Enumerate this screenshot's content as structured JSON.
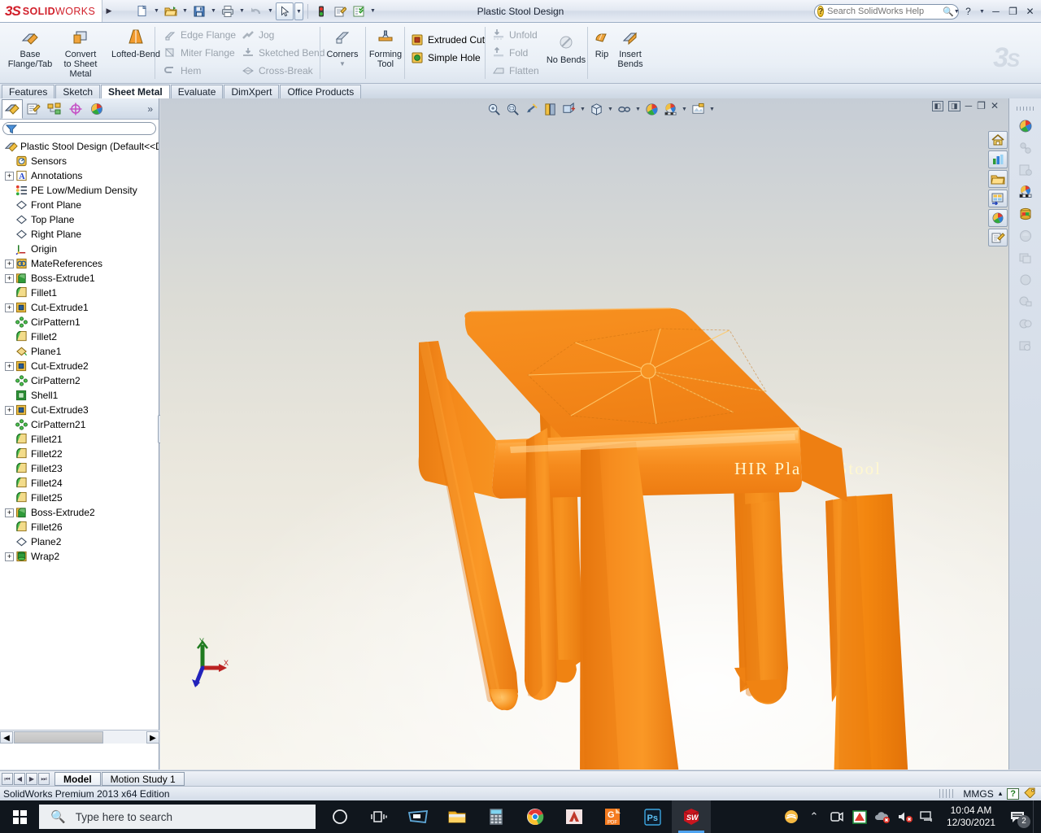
{
  "titlebar": {
    "brand_ds": "3S",
    "brand_name_upper": "SOLID",
    "brand_name_lower": "WORKS",
    "document_title": "Plastic Stool Design",
    "search_placeholder": "Search SolidWorks Help",
    "quick_access": [
      {
        "name": "new-document",
        "glyph": "⬜"
      },
      {
        "name": "open-document",
        "glyph": "📂"
      },
      {
        "name": "save-document",
        "glyph": "💾"
      },
      {
        "name": "print-document",
        "glyph": "🖨"
      },
      {
        "name": "undo",
        "glyph": "↶"
      },
      {
        "name": "select-pointer",
        "glyph": "➤"
      },
      {
        "name": "rebuild-traffic-light",
        "glyph": "🚦"
      },
      {
        "name": "options-gear",
        "glyph": "📝"
      },
      {
        "name": "custom-properties",
        "glyph": "📋"
      }
    ],
    "window_buttons": [
      "help",
      "minimize",
      "restore",
      "close"
    ]
  },
  "ribbon": {
    "groups": [
      {
        "name": "base-group",
        "big_buttons": [
          {
            "label": "Base\nFlange/Tab",
            "icon": "base-flange-icon"
          },
          {
            "label": "Convert\nto Sheet\nMetal",
            "icon": "convert-sheet-metal-icon"
          },
          {
            "label": "Lofted-Bend",
            "icon": "lofted-bend-icon"
          }
        ]
      },
      {
        "name": "flange-group",
        "column_a": [
          {
            "label": "Edge Flange",
            "icon": "edge-flange-icon",
            "enabled": false
          },
          {
            "label": "Miter Flange",
            "icon": "miter-flange-icon",
            "enabled": false
          },
          {
            "label": "Hem",
            "icon": "hem-icon",
            "enabled": false
          }
        ],
        "column_b": [
          {
            "label": "Jog",
            "icon": "jog-icon",
            "enabled": false
          },
          {
            "label": "Sketched Bend",
            "icon": "sketched-bend-icon",
            "enabled": false
          },
          {
            "label": "Cross-Break",
            "icon": "cross-break-icon",
            "enabled": false
          }
        ]
      },
      {
        "name": "corners-group",
        "big_buttons": [
          {
            "label": "Corners",
            "icon": "corners-icon"
          }
        ],
        "has_dropdown": true
      },
      {
        "name": "forming-group",
        "big_buttons": [
          {
            "label": "Forming\nTool",
            "icon": "forming-tool-icon"
          }
        ]
      },
      {
        "name": "cut-group",
        "column_a": [
          {
            "label": "Extruded Cut",
            "icon": "extruded-cut-icon",
            "enabled": true
          },
          {
            "label": "Simple Hole",
            "icon": "simple-hole-icon",
            "enabled": true
          }
        ]
      },
      {
        "name": "fold-group",
        "column_a": [
          {
            "label": "Unfold",
            "icon": "unfold-icon",
            "enabled": false
          },
          {
            "label": "Fold",
            "icon": "fold-icon",
            "enabled": false
          },
          {
            "label": "Flatten",
            "icon": "flatten-icon",
            "enabled": false
          }
        ],
        "big_buttons": [
          {
            "label": "No Bends",
            "icon": "no-bends-icon"
          }
        ]
      },
      {
        "name": "rip-group",
        "big_buttons": [
          {
            "label": "Rip",
            "icon": "rip-icon"
          },
          {
            "label": "Insert\nBends",
            "icon": "insert-bends-icon"
          }
        ]
      }
    ]
  },
  "command_tabs": [
    {
      "label": "Features",
      "active": false
    },
    {
      "label": "Sketch",
      "active": false
    },
    {
      "label": "Sheet Metal",
      "active": true
    },
    {
      "label": "Evaluate",
      "active": false
    },
    {
      "label": "DimXpert",
      "active": false
    },
    {
      "label": "Office Products",
      "active": false
    }
  ],
  "tree_panel": {
    "tabs": [
      {
        "name": "feature-manager-tab",
        "active": true
      },
      {
        "name": "property-manager-tab",
        "active": false
      },
      {
        "name": "configuration-manager-tab",
        "active": false
      },
      {
        "name": "dimxpert-manager-tab",
        "active": false
      },
      {
        "name": "display-manager-tab",
        "active": false
      }
    ],
    "chevron": "»",
    "filter_placeholder": "",
    "root": "Plastic Stool Design  (Default<<D",
    "items": [
      {
        "label": "Sensors",
        "icon": "sensors-icon",
        "expandable": false
      },
      {
        "label": "Annotations",
        "icon": "annotations-icon",
        "expandable": true
      },
      {
        "label": "PE Low/Medium Density",
        "icon": "material-icon",
        "expandable": false
      },
      {
        "label": "Front Plane",
        "icon": "plane-icon",
        "expandable": false
      },
      {
        "label": "Top Plane",
        "icon": "plane-icon",
        "expandable": false
      },
      {
        "label": "Right Plane",
        "icon": "plane-icon",
        "expandable": false
      },
      {
        "label": "Origin",
        "icon": "origin-icon",
        "expandable": false
      },
      {
        "label": "MateReferences",
        "icon": "mate-references-icon",
        "expandable": true
      },
      {
        "label": "Boss-Extrude1",
        "icon": "boss-extrude-icon",
        "expandable": true
      },
      {
        "label": "Fillet1",
        "icon": "fillet-icon",
        "expandable": false
      },
      {
        "label": "Cut-Extrude1",
        "icon": "cut-extrude-icon",
        "expandable": true
      },
      {
        "label": "CirPattern1",
        "icon": "circular-pattern-icon",
        "expandable": false
      },
      {
        "label": "Fillet2",
        "icon": "fillet-icon",
        "expandable": false
      },
      {
        "label": "Plane1",
        "icon": "plane-yellow-icon",
        "expandable": false
      },
      {
        "label": "Cut-Extrude2",
        "icon": "cut-extrude-icon",
        "expandable": true
      },
      {
        "label": "CirPattern2",
        "icon": "circular-pattern-icon",
        "expandable": false
      },
      {
        "label": "Shell1",
        "icon": "shell-icon",
        "expandable": false
      },
      {
        "label": "Cut-Extrude3",
        "icon": "cut-extrude-icon",
        "expandable": true
      },
      {
        "label": "CirPattern21",
        "icon": "circular-pattern-icon",
        "expandable": false
      },
      {
        "label": "Fillet21",
        "icon": "fillet-icon",
        "expandable": false
      },
      {
        "label": "Fillet22",
        "icon": "fillet-icon",
        "expandable": false
      },
      {
        "label": "Fillet23",
        "icon": "fillet-icon",
        "expandable": false
      },
      {
        "label": "Fillet24",
        "icon": "fillet-icon",
        "expandable": false
      },
      {
        "label": "Fillet25",
        "icon": "fillet-icon",
        "expandable": false
      },
      {
        "label": "Boss-Extrude2",
        "icon": "boss-extrude-icon",
        "expandable": true
      },
      {
        "label": "Fillet26",
        "icon": "fillet-icon",
        "expandable": false
      },
      {
        "label": "Plane2",
        "icon": "plane-icon",
        "expandable": false
      },
      {
        "label": "Wrap2",
        "icon": "wrap-icon",
        "expandable": true
      }
    ]
  },
  "view_toolbar": [
    {
      "name": "zoom-to-fit-icon"
    },
    {
      "name": "zoom-to-area-icon"
    },
    {
      "name": "previous-view-icon"
    },
    {
      "name": "section-view-icon"
    },
    {
      "name": "view-orientation-icon",
      "has_caret": true
    },
    {
      "name": "display-style-icon",
      "has_caret": true
    },
    {
      "name": "hide-show-items-icon",
      "has_caret": true
    },
    {
      "name": "edit-appearance-icon"
    },
    {
      "name": "apply-scene-icon",
      "has_caret": true
    },
    {
      "name": "view-settings-icon",
      "has_caret": true
    }
  ],
  "viewport_dock": [
    {
      "name": "view-home-icon"
    },
    {
      "name": "view-chart-icon"
    },
    {
      "name": "view-folder-icon"
    },
    {
      "name": "view-layout-icon"
    },
    {
      "name": "view-appearance-icon"
    },
    {
      "name": "view-custom-icon"
    }
  ],
  "task_pane": [
    {
      "name": "solidworks-resources-icon"
    },
    {
      "name": "design-library-icon"
    },
    {
      "name": "file-explorer-icon"
    },
    {
      "name": "view-palette-icon"
    },
    {
      "name": "appearances-scenes-icon"
    },
    {
      "name": "custom-properties-icon"
    },
    {
      "name": "photoview-items-icon"
    },
    {
      "name": "photoview-options-icon"
    },
    {
      "name": "photoview-scene-icon"
    },
    {
      "name": "photoview-preview-icon"
    },
    {
      "name": "photoview-render-icon"
    }
  ],
  "model": {
    "engraved_text": "HIR Plastic Stool",
    "body_color": "#F4881A",
    "highlight_color": "#FFA733",
    "shadow_color": "#D4700F",
    "engrave_text_color": "#FFF8D0",
    "triad": {
      "x_label": "X",
      "y_label": "Y",
      "z_label": "Z"
    }
  },
  "document_tabs": {
    "nav_buttons": [
      "first",
      "previous",
      "next",
      "last"
    ],
    "tabs": [
      {
        "label": "Model",
        "active": true
      },
      {
        "label": "Motion Study 1",
        "active": false
      }
    ]
  },
  "statusbar": {
    "edition": "SolidWorks Premium 2013 x64 Edition",
    "units": "MMGS",
    "units_caret": "▴",
    "help_glyph": "?",
    "tag_icon": "tag-icon"
  },
  "taskbar": {
    "search_placeholder": "Type here to search",
    "apps": [
      {
        "name": "cortana-icon",
        "glyph": "○",
        "active": false
      },
      {
        "name": "task-view-icon",
        "glyph": "",
        "active": false
      },
      {
        "name": "snipping-tool-icon",
        "glyph": "",
        "active": false
      },
      {
        "name": "file-explorer-icon",
        "glyph": "",
        "active": false
      },
      {
        "name": "calculator-icon",
        "glyph": "",
        "active": false
      },
      {
        "name": "google-chrome-icon",
        "glyph": "",
        "active": false
      },
      {
        "name": "autocad-icon",
        "glyph": "A",
        "active": false
      },
      {
        "name": "gstarcad-pdf-icon",
        "glyph": "G",
        "active": false
      },
      {
        "name": "photoshop-icon",
        "glyph": "Ps",
        "active": false
      },
      {
        "name": "solidworks-icon",
        "glyph": "SW",
        "active": true
      }
    ],
    "tray": [
      {
        "name": "sunshine-app-icon"
      },
      {
        "name": "show-hidden-icons-icon",
        "glyph": "⌃"
      },
      {
        "name": "camera-icon"
      },
      {
        "name": "antivirus-icon"
      },
      {
        "name": "onedrive-error-icon"
      },
      {
        "name": "volume-muted-icon"
      },
      {
        "name": "network-disconnected-icon"
      }
    ],
    "time": "10:04 AM",
    "date": "12/30/2021",
    "notification_count": "2"
  }
}
